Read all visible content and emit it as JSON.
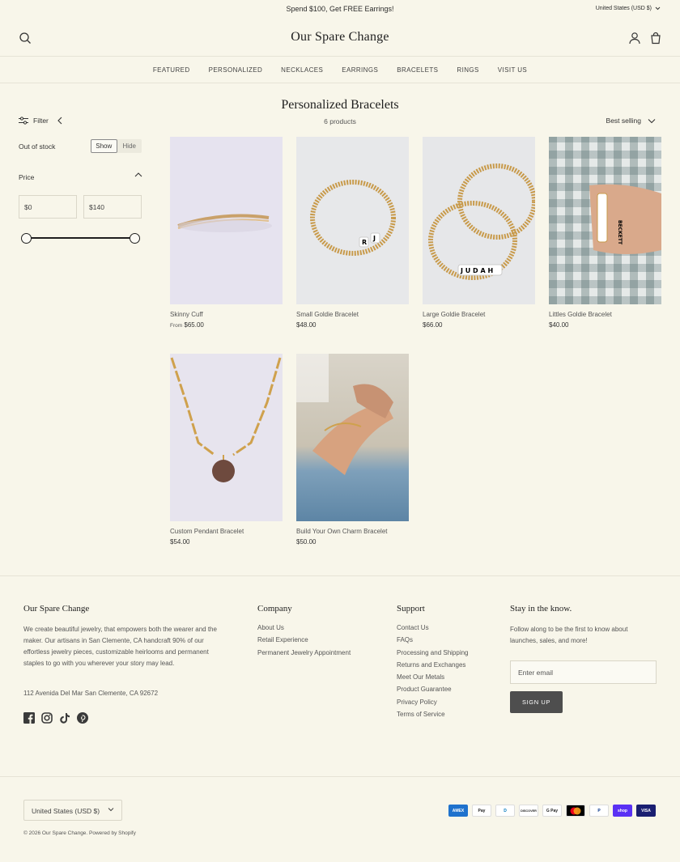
{
  "announcement": {
    "message": "Spend $100, Get FREE Earrings!",
    "currency": "United States (USD $)"
  },
  "header": {
    "logo": "Our Spare Change"
  },
  "nav": [
    "FEATURED",
    "PERSONALIZED",
    "NECKLACES",
    "EARRINGS",
    "BRACELETS",
    "RINGS",
    "VISIT US"
  ],
  "collection": {
    "title": "Personalized Bracelets",
    "count": "6 products"
  },
  "filter": {
    "label": "Filter",
    "out_of_stock": "Out of stock",
    "show": "Show",
    "hide": "Hide",
    "price_label": "Price",
    "min_prefix": "$",
    "min_value": "0",
    "max_prefix": "$",
    "max_value": "140",
    "range_min_fraction": 0,
    "range_max_fraction": 1
  },
  "sort": {
    "label": "Best selling"
  },
  "products": [
    {
      "name": "Skinny Cuff",
      "from": "From",
      "price": "$65.00"
    },
    {
      "name": "Small Goldie Bracelet",
      "price": "$48.00",
      "beads": "R J"
    },
    {
      "name": "Large Goldie Bracelet",
      "price": "$66.00",
      "beads": "J U D A H"
    },
    {
      "name": "Littles Goldie Bracelet",
      "price": "$40.00",
      "beads": "BECKETT"
    },
    {
      "name": "Custom Pendant Bracelet",
      "price": "$54.00"
    },
    {
      "name": "Build Your Own Charm Bracelet",
      "price": "$50.00"
    }
  ],
  "footer": {
    "about_title": "Our Spare Change",
    "about_text": "We create beautiful jewelry, that empowers both the wearer and the maker. Our artisans in San Clemente, CA handcraft 90% of our effortless jewelry pieces, customizable heirlooms and permanent staples to go with you wherever your story may lead.",
    "address": "112 Avenida Del Mar San Clemente, CA 92672",
    "company_title": "Company",
    "company_links": [
      "About Us",
      "Retail Experience",
      "Permanent Jewelry Appointment"
    ],
    "support_title": "Support",
    "support_links": [
      "Contact Us",
      "FAQs",
      "Processing and Shipping",
      "Returns and Exchanges",
      "Meet Our Metals",
      "Product Guarantee",
      "Privacy Policy",
      "Terms of Service"
    ],
    "newsletter_title": "Stay in the know.",
    "newsletter_text": "Follow along to be the first to know about launches, sales, and more!",
    "email_placeholder": "Enter email",
    "signup": "SIGN UP",
    "social": [
      "facebook-icon",
      "instagram-icon",
      "tiktok-icon",
      "pinterest-icon"
    ],
    "currency": "United States (USD $)",
    "copyright": "© 2026 Our Spare Change. Powered by Shopify",
    "payments": [
      "AMEX",
      "Pay",
      "D",
      "DISCOVER",
      "G Pay",
      "",
      "P",
      "shop",
      "VISA"
    ]
  },
  "colors": {
    "background": "#f8f6ea",
    "button": "#4e4e4e",
    "gold": "#c89a4a"
  }
}
